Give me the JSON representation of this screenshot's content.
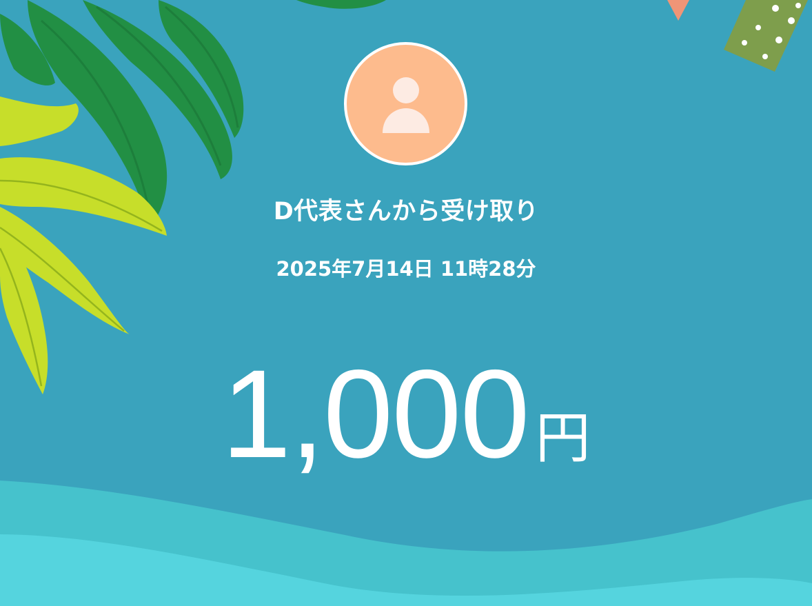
{
  "transfer": {
    "title": "D代表さんから受け取り",
    "datetime": "2025年7月14日 11時28分",
    "amount": "1,000",
    "currency_unit": "円"
  },
  "avatar": {
    "icon": "person-icon",
    "background_color": "#fdbb8d"
  },
  "theme": {
    "background_color": "#3aa3bd",
    "palm_leaf_colors": [
      "#228f44",
      "#c7de2a"
    ],
    "sea_colors": [
      "#46c2cc",
      "#55d4de"
    ],
    "bunting_colors": [
      "#7e9e4c",
      "#f09577"
    ]
  }
}
